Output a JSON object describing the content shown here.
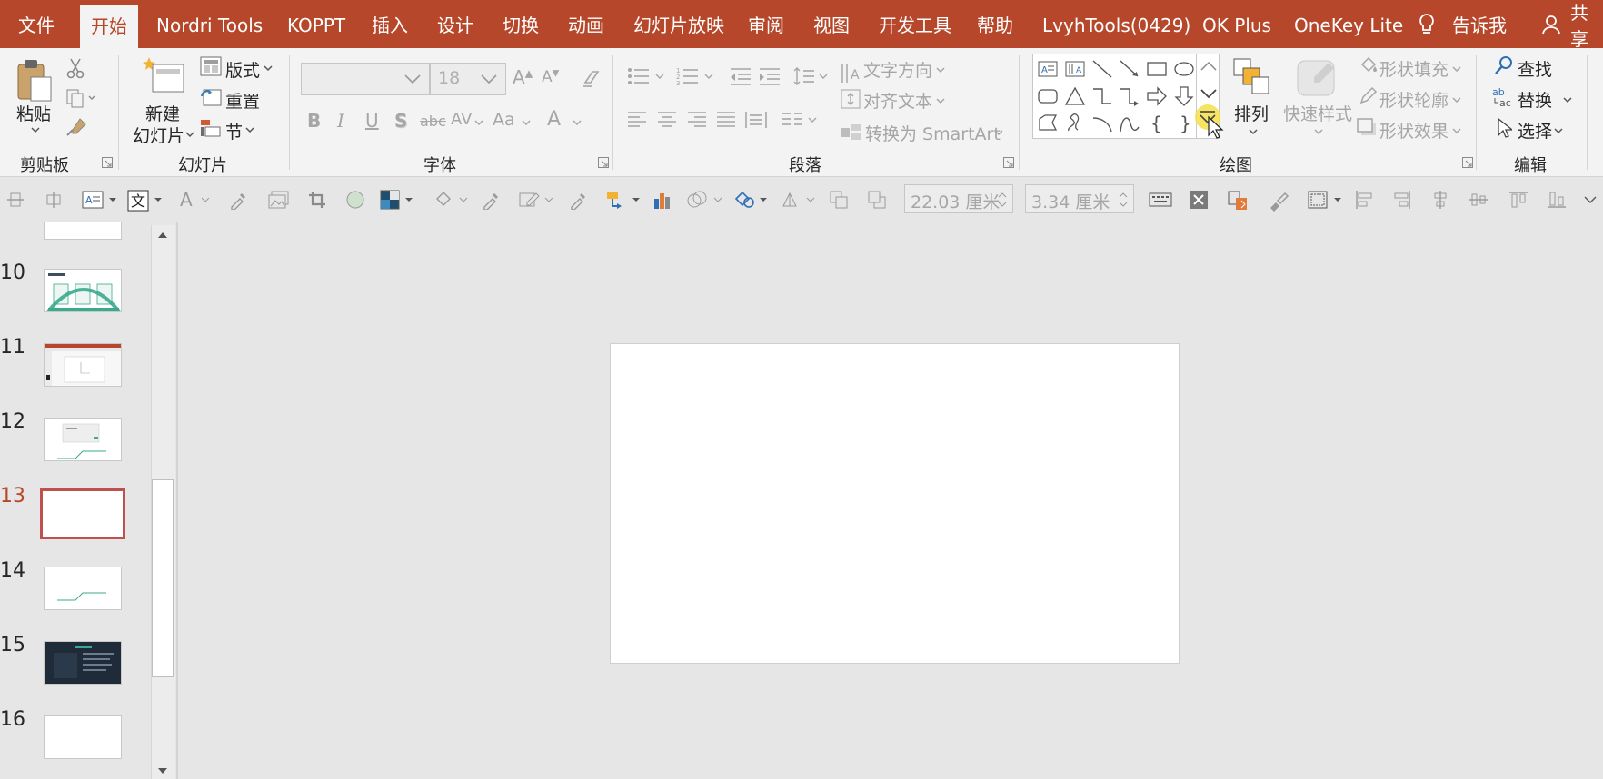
{
  "tabs": [
    {
      "label": "文件"
    },
    {
      "label": "开始"
    },
    {
      "label": "Nordri Tools"
    },
    {
      "label": "KOPPT"
    },
    {
      "label": "插入"
    },
    {
      "label": "设计"
    },
    {
      "label": "切换"
    },
    {
      "label": "动画"
    },
    {
      "label": "幻灯片放映"
    },
    {
      "label": "审阅"
    },
    {
      "label": "视图"
    },
    {
      "label": "开发工具"
    },
    {
      "label": "帮助"
    },
    {
      "label": "LvyhTools(0429)"
    },
    {
      "label": "OK Plus"
    },
    {
      "label": "OneKey Lite"
    }
  ],
  "tell_me": "告诉我",
  "share": "共享",
  "groups": {
    "clipboard": {
      "label": "剪贴板",
      "paste": "粘贴"
    },
    "slides": {
      "label": "幻灯片",
      "new_slide_1": "新建",
      "new_slide_2": "幻灯片",
      "layout": "版式",
      "reset": "重置",
      "section": "节"
    },
    "font": {
      "label": "字体",
      "font_size": "18",
      "bold": "B",
      "italic": "I",
      "underline": "U",
      "shadow": "S",
      "strike": "abc",
      "spacing": "AV",
      "case": "Aa",
      "color": "A"
    },
    "paragraph": {
      "label": "段落",
      "text_direction": "文字方向",
      "align_text": "对齐文本",
      "smartart": "转换为 SmartArt"
    },
    "drawing": {
      "label": "绘图",
      "arrange": "排列",
      "quick_styles": "快速样式",
      "fill": "形状填充",
      "outline": "形状轮廓",
      "effects": "形状效果"
    },
    "editing": {
      "label": "编辑",
      "find": "查找",
      "replace": "替换",
      "select": "选择"
    }
  },
  "toolbar2": {
    "width_value": "22.03 厘米",
    "height_value": "3.34 厘米"
  },
  "slides": [
    {
      "number": "10"
    },
    {
      "number": "11"
    },
    {
      "number": "12"
    },
    {
      "number": "13"
    },
    {
      "number": "14"
    },
    {
      "number": "15"
    },
    {
      "number": "16"
    }
  ],
  "selected_slide": "13",
  "colors": {
    "accent": "#b7472a",
    "ribbon_bg": "#f3f3f3",
    "selection_border": "#c0504d",
    "highlight": "#f5e04a",
    "thumb_green": "#3aaa8c"
  }
}
